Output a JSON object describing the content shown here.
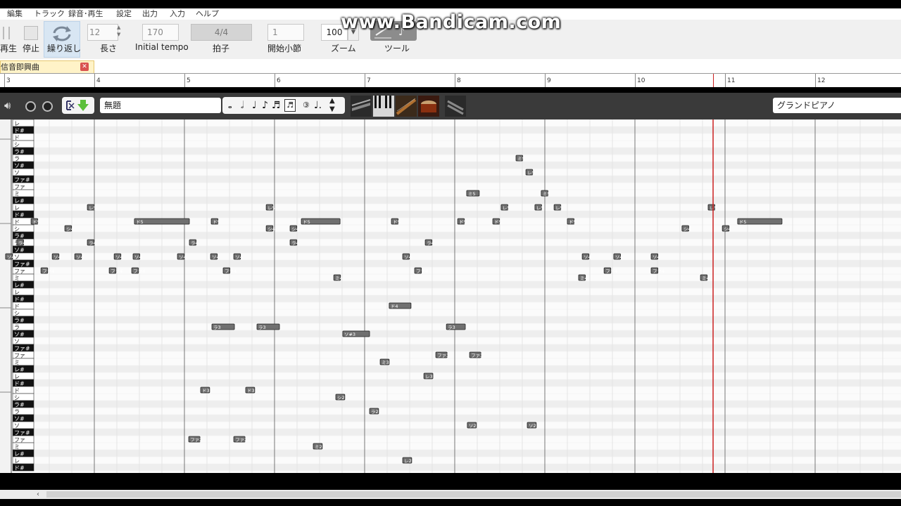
{
  "menu": [
    "編集",
    "トラック",
    "録音･再生",
    "設定",
    "出力",
    "入力",
    "ヘルプ"
  ],
  "toolbar": {
    "play_label": "再生",
    "stop_label": "停止",
    "loop_label": "繰り返し",
    "length_label": "長さ",
    "length_value": "12",
    "tempo_label": "Initial tempo",
    "tempo_value": "170",
    "beat_label": "拍子",
    "beat_value": "4/4",
    "start_bar_label": "開始小節",
    "start_bar_value": "1",
    "zoom_label": "ズーム",
    "zoom_value": "100",
    "tool_label": "ツール"
  },
  "watermark": "www.Bandicam.com",
  "tab": {
    "title": "信音即興曲"
  },
  "ruler": {
    "bars": [
      "3",
      "4",
      "5",
      "6",
      "7",
      "8",
      "9",
      "10",
      "11",
      "12"
    ]
  },
  "track": {
    "name": "無題",
    "instrument": "グランドピアノ",
    "note_buttons": [
      "𝅝",
      "𝅗𝅥",
      "♩",
      "♪",
      "♬",
      "3",
      "♩."
    ]
  },
  "piano_keys": [
    {
      "label": "レ",
      "black": false
    },
    {
      "label": "ド#",
      "black": true
    },
    {
      "label": "ド",
      "black": false
    },
    {
      "label": "シ",
      "black": false
    },
    {
      "label": "ラ#",
      "black": true
    },
    {
      "label": "ラ",
      "black": false
    },
    {
      "label": "ソ#",
      "black": true
    },
    {
      "label": "ソ",
      "black": false
    },
    {
      "label": "ファ#",
      "black": true
    },
    {
      "label": "ファ",
      "black": false
    },
    {
      "label": "ミ",
      "black": false
    },
    {
      "label": "レ#",
      "black": true
    },
    {
      "label": "レ",
      "black": false
    },
    {
      "label": "ド#",
      "black": true
    },
    {
      "label": "ド",
      "black": false
    },
    {
      "label": "シ",
      "black": false
    },
    {
      "label": "ラ#",
      "black": true
    },
    {
      "label": "ラ",
      "black": false
    },
    {
      "label": "ソ#",
      "black": true
    },
    {
      "label": "ソ",
      "black": false
    },
    {
      "label": "ファ#",
      "black": true
    },
    {
      "label": "ファ",
      "black": false
    },
    {
      "label": "ミ",
      "black": false
    },
    {
      "label": "レ#",
      "black": true
    },
    {
      "label": "レ",
      "black": false
    },
    {
      "label": "ド#",
      "black": true
    },
    {
      "label": "ド",
      "black": false
    },
    {
      "label": "シ",
      "black": false
    },
    {
      "label": "ラ#",
      "black": true
    },
    {
      "label": "ラ",
      "black": false
    },
    {
      "label": "ソ#",
      "black": true
    },
    {
      "label": "ソ",
      "black": false
    },
    {
      "label": "ファ#",
      "black": true
    },
    {
      "label": "ファ",
      "black": false
    },
    {
      "label": "ミ",
      "black": false
    },
    {
      "label": "レ#",
      "black": true
    },
    {
      "label": "レ",
      "black": false
    },
    {
      "label": "ド#",
      "black": true
    },
    {
      "label": "ド",
      "black": false
    },
    {
      "label": "シ",
      "black": false
    },
    {
      "label": "ラ#",
      "black": true
    },
    {
      "label": "ラ",
      "black": false
    },
    {
      "label": "ソ#",
      "black": true
    },
    {
      "label": "ソ",
      "black": false
    },
    {
      "label": "ファ#",
      "black": true
    },
    {
      "label": "ファ",
      "black": false
    },
    {
      "label": "ミ",
      "black": false
    },
    {
      "label": "レ#",
      "black": true
    },
    {
      "label": "レ",
      "black": false
    },
    {
      "label": "ド#",
      "black": true
    }
  ],
  "notes": [
    {
      "row": 5,
      "beat": 22.72,
      "len": 0.3,
      "text": "ミ5"
    },
    {
      "row": 7,
      "beat": 23.16,
      "len": 0.3,
      "text": "レ5"
    },
    {
      "row": 10,
      "beat": 20.53,
      "len": 0.56,
      "text": "ミ5"
    },
    {
      "row": 10,
      "beat": 23.84,
      "len": 0.3,
      "text": "ミ5"
    },
    {
      "row": 12,
      "beat": 3.69,
      "len": 0.3,
      "text": "レ5"
    },
    {
      "row": 12,
      "beat": 11.63,
      "len": 0.3,
      "text": "レ5"
    },
    {
      "row": 12,
      "beat": 22.06,
      "len": 0.3,
      "text": "レ5"
    },
    {
      "row": 12,
      "beat": 23.56,
      "len": 0.3,
      "text": "レ5"
    },
    {
      "row": 12,
      "beat": 24.41,
      "len": 0.3,
      "text": "レ5"
    },
    {
      "row": 12,
      "beat": 31.25,
      "len": 0.3,
      "text": "レ5"
    },
    {
      "row": 14,
      "beat": 1.19,
      "len": 0.3,
      "text": "ド5"
    },
    {
      "row": 14,
      "beat": 5.78,
      "len": 2.44,
      "text": "ド5"
    },
    {
      "row": 14,
      "beat": 9.19,
      "len": 0.3,
      "text": "ド5"
    },
    {
      "row": 14,
      "beat": 13.19,
      "len": 1.72,
      "text": "ド5"
    },
    {
      "row": 14,
      "beat": 17.19,
      "len": 0.3,
      "text": "ド5"
    },
    {
      "row": 14,
      "beat": 20.13,
      "len": 0.3,
      "text": "ド5"
    },
    {
      "row": 14,
      "beat": 21.69,
      "len": 0.3,
      "text": "ド5"
    },
    {
      "row": 14,
      "beat": 25.0,
      "len": 0.3,
      "text": "ド5"
    },
    {
      "row": 14,
      "beat": 32.56,
      "len": 1.97,
      "text": "ド5"
    },
    {
      "row": 15,
      "beat": 2.69,
      "len": 0.3,
      "text": "シ4"
    },
    {
      "row": 15,
      "beat": 11.63,
      "len": 0.3,
      "text": "シ4"
    },
    {
      "row": 15,
      "beat": 12.69,
      "len": 0.3,
      "text": "シ4"
    },
    {
      "row": 15,
      "beat": 30.09,
      "len": 0.3,
      "text": "シ4"
    },
    {
      "row": 15,
      "beat": 31.88,
      "len": 0.3,
      "text": "シ4"
    },
    {
      "row": 17,
      "beat": 0.56,
      "len": 0.3,
      "text": "ラ4"
    },
    {
      "row": 17,
      "beat": 3.69,
      "len": 0.3,
      "text": "ラ4"
    },
    {
      "row": 17,
      "beat": 8.22,
      "len": 0.3,
      "text": "ラ4"
    },
    {
      "row": 17,
      "beat": 12.69,
      "len": 0.3,
      "text": "ラ4"
    },
    {
      "row": 17,
      "beat": 18.69,
      "len": 0.3,
      "text": "ラ4"
    },
    {
      "row": 19,
      "beat": 0.06,
      "len": 0.3,
      "text": "ソ4"
    },
    {
      "row": 19,
      "beat": 2.13,
      "len": 0.3,
      "text": "ソ4"
    },
    {
      "row": 19,
      "beat": 3.13,
      "len": 0.3,
      "text": "ソ4"
    },
    {
      "row": 19,
      "beat": 4.88,
      "len": 0.3,
      "text": "ソ4"
    },
    {
      "row": 19,
      "beat": 5.72,
      "len": 0.3,
      "text": "ソ4"
    },
    {
      "row": 19,
      "beat": 7.69,
      "len": 0.3,
      "text": "ソ4"
    },
    {
      "row": 19,
      "beat": 9.16,
      "len": 0.3,
      "text": "ソ4"
    },
    {
      "row": 19,
      "beat": 10.19,
      "len": 0.3,
      "text": "ソ4"
    },
    {
      "row": 19,
      "beat": 17.69,
      "len": 0.3,
      "text": "ソ4"
    },
    {
      "row": 19,
      "beat": 25.66,
      "len": 0.3,
      "text": "ソ4"
    },
    {
      "row": 19,
      "beat": 27.06,
      "len": 0.3,
      "text": "ソ4"
    },
    {
      "row": 19,
      "beat": 28.72,
      "len": 0.3,
      "text": "ソ4"
    },
    {
      "row": 21,
      "beat": 1.63,
      "len": 0.3,
      "text": "ファ4"
    },
    {
      "row": 21,
      "beat": 4.66,
      "len": 0.3,
      "text": "ファ4"
    },
    {
      "row": 21,
      "beat": 5.66,
      "len": 0.3,
      "text": "ファ4"
    },
    {
      "row": 21,
      "beat": 9.72,
      "len": 0.3,
      "text": "ファ4"
    },
    {
      "row": 21,
      "beat": 18.22,
      "len": 0.3,
      "text": "ファ4"
    },
    {
      "row": 21,
      "beat": 26.63,
      "len": 0.3,
      "text": "ファ4"
    },
    {
      "row": 21,
      "beat": 28.72,
      "len": 0.3,
      "text": "ファ4"
    },
    {
      "row": 22,
      "beat": 14.63,
      "len": 0.3,
      "text": "ミ4"
    },
    {
      "row": 22,
      "beat": 25.5,
      "len": 0.3,
      "text": "ミ4"
    },
    {
      "row": 22,
      "beat": 30.91,
      "len": 0.3,
      "text": "ミ4"
    },
    {
      "row": 26,
      "beat": 17.09,
      "len": 0.97,
      "text": "ド4"
    },
    {
      "row": 29,
      "beat": 9.22,
      "len": 1.0,
      "text": "ラ3"
    },
    {
      "row": 29,
      "beat": 11.22,
      "len": 1.0,
      "text": "ラ3"
    },
    {
      "row": 29,
      "beat": 19.63,
      "len": 0.84,
      "text": "ラ3"
    },
    {
      "row": 30,
      "beat": 15.03,
      "len": 1.19,
      "text": "ソ#3"
    },
    {
      "row": 33,
      "beat": 19.16,
      "len": 0.5,
      "text": "ファ3"
    },
    {
      "row": 33,
      "beat": 20.66,
      "len": 0.5,
      "text": "ファ3"
    },
    {
      "row": 34,
      "beat": 16.69,
      "len": 0.4,
      "text": "ミ3"
    },
    {
      "row": 36,
      "beat": 18.63,
      "len": 0.4,
      "text": "レ3"
    },
    {
      "row": 38,
      "beat": 8.72,
      "len": 0.4,
      "text": "ド3"
    },
    {
      "row": 38,
      "beat": 10.72,
      "len": 0.4,
      "text": "ド3"
    },
    {
      "row": 39,
      "beat": 14.72,
      "len": 0.4,
      "text": "シ2"
    },
    {
      "row": 41,
      "beat": 16.22,
      "len": 0.4,
      "text": "ラ2"
    },
    {
      "row": 43,
      "beat": 20.56,
      "len": 0.4,
      "text": "ソ2"
    },
    {
      "row": 43,
      "beat": 23.22,
      "len": 0.4,
      "text": "ソ2"
    },
    {
      "row": 45,
      "beat": 8.19,
      "len": 0.5,
      "text": "ファ2"
    },
    {
      "row": 45,
      "beat": 10.19,
      "len": 0.5,
      "text": "ファ2"
    },
    {
      "row": 46,
      "beat": 13.72,
      "len": 0.4,
      "text": "ミ2"
    },
    {
      "row": 48,
      "beat": 17.69,
      "len": 0.4,
      "text": "レ2"
    }
  ],
  "cursor": {
    "beat": 31.47
  }
}
